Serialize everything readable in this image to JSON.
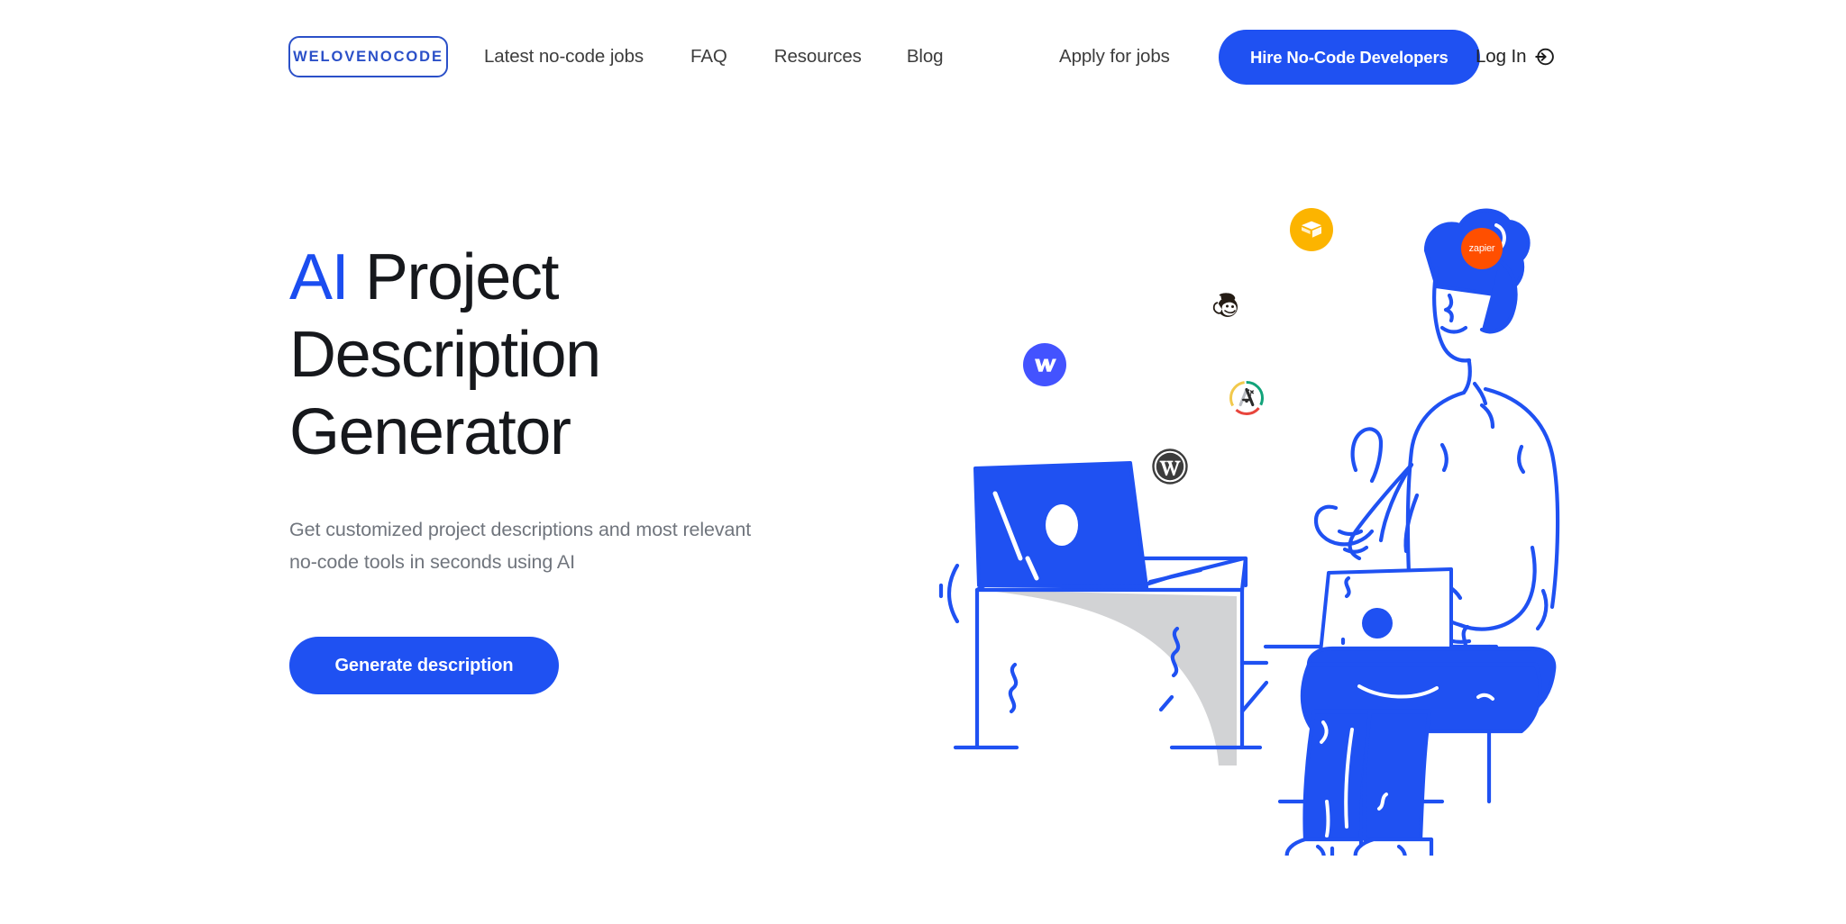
{
  "brand": {
    "logo_text": "WELOVENOCODE",
    "accent_color": "#1f51f2",
    "logo_border_color": "#2b50c8",
    "headline_accent_color": "#1b4df0"
  },
  "nav": {
    "links": [
      {
        "label": "Latest no-code jobs",
        "name": "nav-link-latest-no-code-jobs"
      },
      {
        "label": "FAQ",
        "name": "nav-link-faq"
      },
      {
        "label": "Resources",
        "name": "nav-link-resources"
      },
      {
        "label": "Blog",
        "name": "nav-link-blog"
      }
    ],
    "apply_label": "Apply for jobs",
    "hire_button_label": "Hire No-Code Developers",
    "login_label": "Log In",
    "login_icon": "login-arrow-icon"
  },
  "hero": {
    "headline_accent": "AI",
    "headline_rest": " Project Description Generator",
    "headline_full": "AI Project Description Generator",
    "subheadline": "Get customized project descriptions and most relevant no-code tools in seconds using AI",
    "cta_label": "Generate description"
  },
  "illustration": {
    "description": "Blue line-art of a person sitting holding a laptop beside a desk with an open laptop",
    "line_color": "#1f51f2",
    "shadow_color": "#cfd0d2",
    "badges": [
      {
        "name": "webflow-logo-icon",
        "label": "Webflow",
        "color": "#4353ff"
      },
      {
        "name": "airtable-logo-icon",
        "label": "Airtable",
        "color": "#fcb400"
      },
      {
        "name": "zapier-logo-icon",
        "label": "Zapier",
        "color": "#ff4f00",
        "word": "zapier"
      },
      {
        "name": "mailchimp-logo-icon",
        "label": "Mailchimp",
        "color": "#241c15"
      },
      {
        "name": "adalo-logo-icon",
        "label": "Adalo",
        "color": "#ffffff"
      },
      {
        "name": "wordpress-logo-icon",
        "label": "WordPress",
        "color": "#3c3c3c"
      }
    ]
  }
}
